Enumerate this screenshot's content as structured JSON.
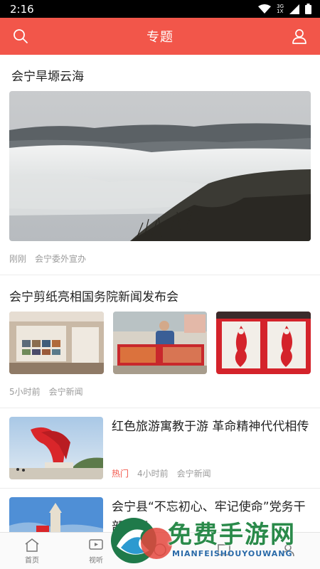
{
  "status_bar": {
    "time": "2:16",
    "net_3g": "3G",
    "net_1x": "1X"
  },
  "header": {
    "title": "专题"
  },
  "articles": [
    {
      "title": "会宁旱塬云海",
      "time": "刚刚",
      "source": "会宁委外宣办"
    },
    {
      "title": "会宁剪纸亮相国务院新闻发布会",
      "time": "5小时前",
      "source": "会宁新闻"
    },
    {
      "title": "红色旅游寓教于游 革命精神代代相传",
      "tag": "热门",
      "time": "4小时前",
      "source": "会宁新闻"
    },
    {
      "title": "会宁县“不忘初心、牢记使命”党务干部专题"
    }
  ],
  "tabs": [
    {
      "label": "首页",
      "icon": "home-icon"
    },
    {
      "label": "视听",
      "icon": "video-icon"
    },
    {
      "label": "",
      "icon": "tab3-icon"
    },
    {
      "label": "",
      "icon": "tab4-icon"
    },
    {
      "label": "",
      "icon": "tab5-icon"
    }
  ],
  "watermark": {
    "text": "免费手游网",
    "sub": "MIANFEISHOUYOUWANG"
  },
  "colors": {
    "accent": "#f2564a"
  }
}
